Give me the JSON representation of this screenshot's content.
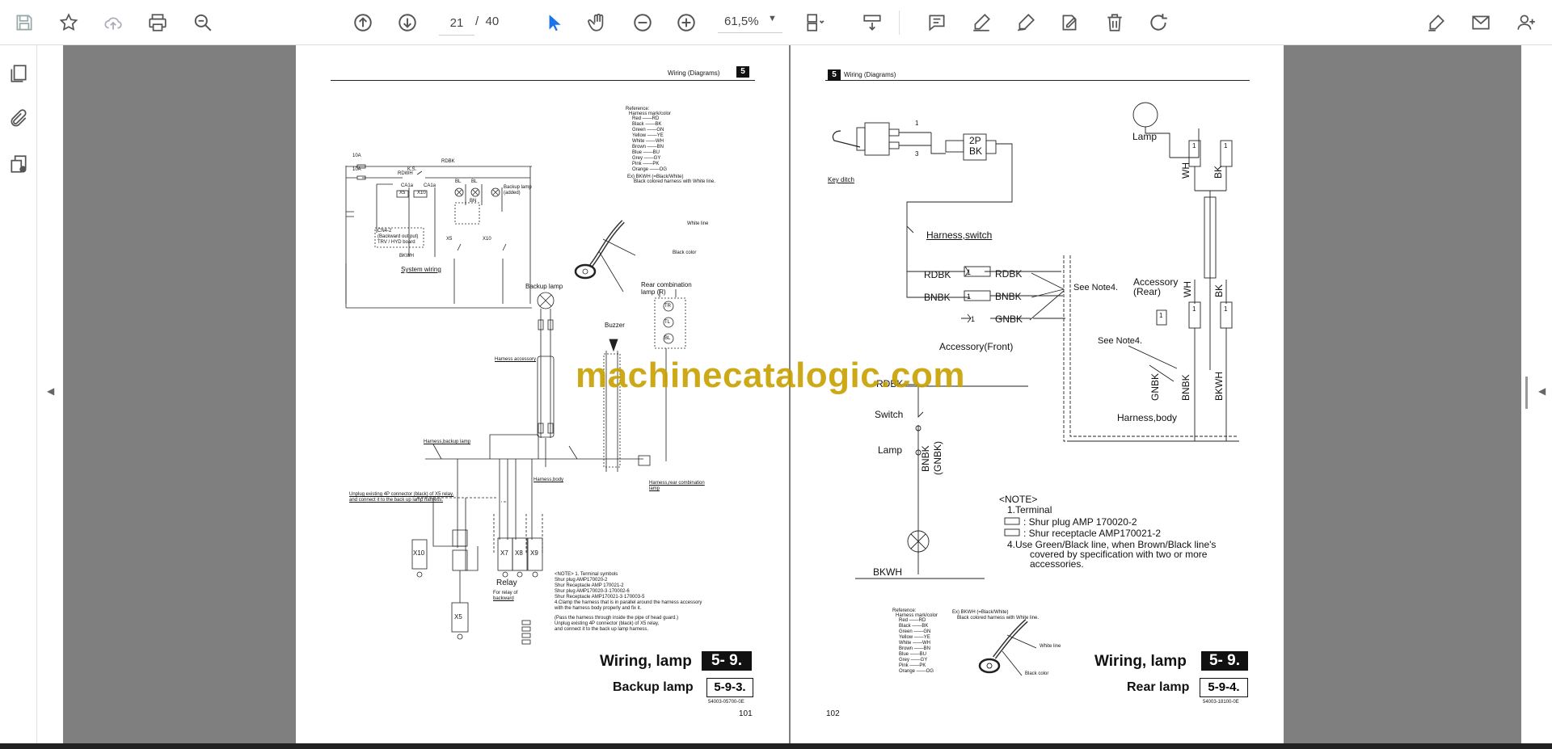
{
  "toolbar": {
    "page_current": "21",
    "page_separator": "/",
    "page_total": "40",
    "zoom": "61,5%",
    "icons": [
      "save-icon",
      "bookmark-star-icon",
      "cloud-upload-icon",
      "print-icon",
      "zoom-search-icon",
      "page-up-icon",
      "page-down-icon",
      "select-cursor-icon",
      "hand-icon",
      "zoom-out-icon",
      "zoom-in-icon",
      "fit-page-icon",
      "scroll-mode-icon",
      "comment-icon",
      "highlight-pen-icon",
      "draw-icon",
      "stamp-icon",
      "delete-icon",
      "rotate-icon",
      "edit-sign-icon",
      "email-icon",
      "add-user-icon"
    ]
  },
  "sidebar": {
    "icons": [
      "pages-icon",
      "attachment-icon",
      "layers-icon"
    ]
  },
  "watermark": "machinecatalogic.com",
  "left_page": {
    "header": "Wiring (Diagrams)",
    "section_num": "5",
    "system_wiring": {
      "fuse1": "10A",
      "fuse2": "10A",
      "ks": "K.S.",
      "rdbk": "RDBK",
      "rdwh": "RDWH",
      "ca1a_1": "CA1a",
      "ca1a_2": "CA1a",
      "x5": "X5",
      "x10": "X10",
      "bl1": "BL",
      "bl2": "BL",
      "bn": "BN",
      "backup_lamp": "Backup lamp",
      "added": "(added)",
      "cn": "CN4-2",
      "cn_note1": "(Backward out put)",
      "cn_note2": "TRV / HYD board",
      "x5b": "X5",
      "x10b": "X10",
      "bkwh": "BKWH",
      "title": "System wiring"
    },
    "reference": {
      "title": "Reference:",
      "sub": "Harness mark/color",
      "rows": [
        "Red ——RD",
        "Black ——BK",
        "Green ——GN",
        "Yellow ——YE",
        "White ——WH",
        "Brown ——BN",
        "Blue ——BU",
        "Grey ——GY",
        "Pink ——PK",
        "Orange ——OG"
      ],
      "ex": "Ex) BKWH (=Black/White)",
      "ex2": "Black colored harness with White line.",
      "white_line": "White line",
      "black_color": "Black color"
    },
    "labels": {
      "backup_lamp": "Backup lamp",
      "rear_combo": "Rear combination",
      "rear_combo2": "lamp (R)",
      "buzzer": "Buzzer",
      "harness_accessory": "Harness accessory",
      "harness_backup": "Harness,backup lamp",
      "harness_body": "Harness,body",
      "harness_rear": "Harness,rear combination",
      "harness_rear2": "lamp",
      "unplug1": "Unplug existing 4P connector (black) of X5 relay,",
      "unplug2": "and connect it to the back up lamp harness.",
      "x10": "X10",
      "x7": "X7",
      "x8": "X8",
      "x9": "X9",
      "x5": "X5",
      "relay": "Relay",
      "for_relay": "For relay of",
      "backward": "backward",
      "tr": "TR",
      "tl": "TL",
      "bl": "BL"
    },
    "note": {
      "l1": "<NOTE> 1. Terminal symbols",
      "l2": "         Shur plug        AMP170020-2",
      "l3": "         Shur Receptacle  AMP 170021-2",
      "l4": "         Shur plug   AMP170020-3·170002-6",
      "l5": "         Shur Receptacle  AMP170021-3·170003-5",
      "l6": "4.Clamp the harness that is in parallel around the harness accessory",
      "l7": "  with the harness body properly and fix it.",
      "l8": "(Pass the harness through inside the pipe of head guard.)",
      "l9": "Unplug existing 4P connector (black) of X5 relay,",
      "l10": "and connect it to the back up lamp harness."
    },
    "title": "Wiring, lamp",
    "title_num": "5- 9.",
    "subtitle": "Backup lamp",
    "subtitle_num": "5-9-3.",
    "doc_code": "54003-05700-0E",
    "page_num": "101"
  },
  "right_page": {
    "section_num": "5",
    "header": "Wiring (Diagrams)",
    "labels": {
      "lamp_top": "Lamp",
      "key_ditch": "Key ditch",
      "pin1": "1",
      "pin3": "3",
      "conn_2p": "2P",
      "conn_bk": "BK",
      "harness_switch": "Harness,switch",
      "rdbk_l": "RDBK",
      "rdbk_r": "RDBK",
      "bnbk_l": "BNBK",
      "bnbk_r": "BNBK",
      "gnbk": "GNBK",
      "see_note4a": "See Note4.",
      "see_note4b": "See Note4.",
      "accessory_front": "Accessory(Front)",
      "accessory_rear": "Accessory",
      "accessory_rear2": "(Rear)",
      "wh_top": "WH",
      "bk_top": "BK",
      "wh_mid": "WH",
      "bk_mid": "BK",
      "gnbk_v": "GNBK",
      "bnbk_v": "BNBK",
      "bkwh_v": "BKWH",
      "harness_body": "Harness,body",
      "rdbk_sw": "RDBK",
      "switch": "Switch",
      "lamp_sw": "Lamp",
      "bnbk_sw": "BNBK",
      "gnbk_sw": "(GNBK)",
      "bkwh_sw": "BKWH"
    },
    "note": {
      "l1": "<NOTE>",
      "l2": "1.Terminal",
      "l3": ": Shur plug   AMP 170020-2",
      "l4": ": Shur receptacle  AMP170021-2",
      "l5": "4.Use Green/Black line, when Brown/Black line's",
      "l6": "covered by specification with two or more",
      "l7": "accessories."
    },
    "reference": {
      "title": "Reference:",
      "sub": "Harness mark/color",
      "rows": [
        "Red ——RD",
        "Black ——BK",
        "Green ——GN",
        "Yellow ——YE",
        "White ——WH",
        "Brown ——BN",
        "Blue ——BU",
        "Grey ——GY",
        "Pink ——PK",
        "Orange ——OG"
      ],
      "ex": "Ex) BKWH (=Black/White)",
      "ex2": "Black colored harness with White line.",
      "white_line": "White line",
      "black_color": "Black color"
    },
    "title": "Wiring, lamp",
    "title_num": "5- 9.",
    "subtitle": "Rear lamp",
    "subtitle_num": "5-9-4.",
    "doc_code": "54003-18100-0E",
    "page_num": "102"
  }
}
